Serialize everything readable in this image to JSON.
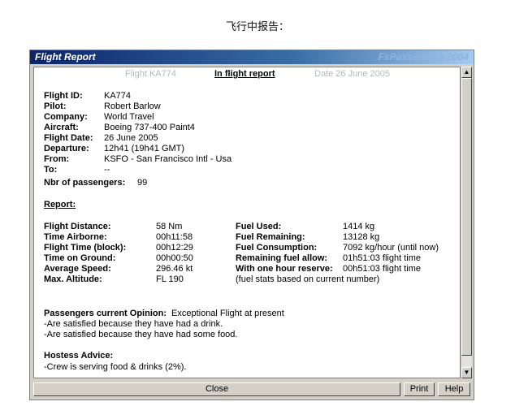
{
  "caption": "飞行中报告：",
  "window": {
    "title": "Flight Report",
    "brand": "FsPassengers 2004"
  },
  "header": {
    "flight": "Flight KA774",
    "title": "In flight report",
    "date": "Date 26 June 2005"
  },
  "info": [
    {
      "label": "Flight ID:",
      "value": "KA774"
    },
    {
      "label": "Pilot:",
      "value": "Robert Barlow"
    },
    {
      "label": "Company:",
      "value": "World Travel"
    },
    {
      "label": "Aircraft:",
      "value": "Boeing 737-400 Paint4"
    },
    {
      "label": "Flight Date:",
      "value": "26 June 2005"
    },
    {
      "label": "Departure:",
      "value": "12h41 (19h41 GMT)"
    },
    {
      "label": "From:",
      "value": "KSFO - San Francisco Intl - Usa"
    },
    {
      "label": "To:",
      "value": "--"
    }
  ],
  "passengers": {
    "label": "Nbr of passengers:",
    "value": "99"
  },
  "report_heading": "Report:",
  "stats_left": [
    {
      "label": "Flight Distance:",
      "value": "58 Nm"
    },
    {
      "label": "Time Airborne:",
      "value": "00h11:58"
    },
    {
      "label": "Flight Time (block):",
      "value": "00h12:29"
    },
    {
      "label": "Time on Ground:",
      "value": "00h00:50"
    },
    {
      "label": "Average Speed:",
      "value": "296.46 kt"
    },
    {
      "label": "Max. Altitude:",
      "value": "FL 190"
    }
  ],
  "stats_right": [
    {
      "label": "Fuel Used:",
      "value": "1414 kg"
    },
    {
      "label": "Fuel Remaining:",
      "value": "13128 kg"
    },
    {
      "label": "Fuel Consumption:",
      "value": "7092 kg/hour (until now)"
    },
    {
      "label": "Remaining fuel allow:",
      "value": "01h51:03 flight time"
    },
    {
      "label": "With one hour reserve:",
      "value": "00h51:03 flight time"
    }
  ],
  "fuel_note": "(fuel stats based on current number)",
  "opinion": {
    "label": "Passengers current Opinion:",
    "value": "Exceptional Flight at present",
    "lines": [
      "-Are satisfied because they have had a drink.",
      "-Are satisfied because they have had some food."
    ]
  },
  "hostess": {
    "label": "Hostess Advice:",
    "lines": [
      "-Crew is serving food & drinks (2%)."
    ]
  },
  "buttons": {
    "close": "Close",
    "print": "Print",
    "help": "Help"
  },
  "scrollbar": {
    "up": "▲",
    "down": "▼"
  }
}
